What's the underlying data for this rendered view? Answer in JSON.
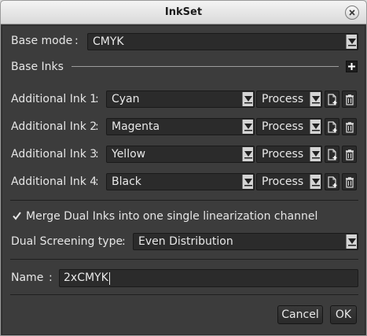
{
  "window": {
    "title": "InkSet"
  },
  "base_mode": {
    "label": "Base mode",
    "value": "CMYK"
  },
  "base_inks": {
    "label": "Base Inks"
  },
  "additional_inks": [
    {
      "label": "Additional Ink 1",
      "ink": "Cyan",
      "type": "Process"
    },
    {
      "label": "Additional Ink 2",
      "ink": "Magenta",
      "type": "Process"
    },
    {
      "label": "Additional Ink 3",
      "ink": "Yellow",
      "type": "Process"
    },
    {
      "label": "Additional Ink 4",
      "ink": "Black",
      "type": "Process"
    }
  ],
  "merge_dual_inks": {
    "label": "Merge Dual Inks into one single linearization channel",
    "checked": true
  },
  "dual_screening": {
    "label": "Dual Screening type",
    "value": "Even Distribution"
  },
  "name_field": {
    "label": "Name",
    "value": "2xCMYK"
  },
  "buttons": {
    "cancel": "Cancel",
    "ok": "OK"
  },
  "separator": ":"
}
